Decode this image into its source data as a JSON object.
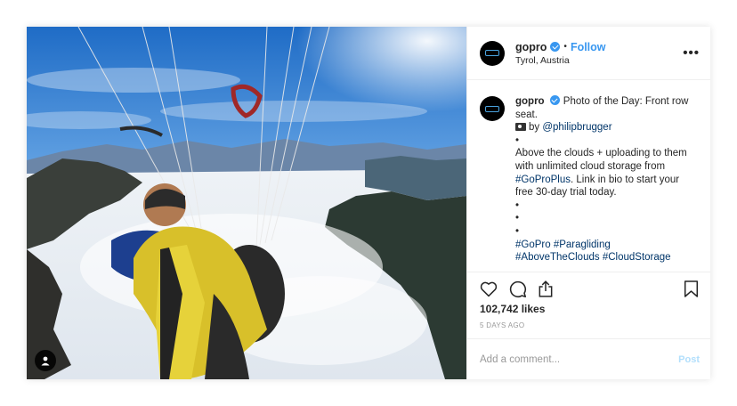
{
  "post": {
    "username": "gopro",
    "follow_label": "Follow",
    "separator": "•",
    "location": "Tyrol, Austria",
    "more_label": "•••"
  },
  "caption": {
    "username": "gopro",
    "line1": "Photo of the Day: Front row seat.",
    "by_label": "by",
    "credit": "@philipbrugger",
    "bullet": "•",
    "body1": "Above the clouds + uploading to them with unlimited cloud storage from",
    "body_tag": "#GoProPlus",
    "body2": ". Link in bio to start your free 30-day trial today.",
    "tags_line1": [
      "#GoPro",
      "#Paragliding"
    ],
    "tags_line2": [
      "#AboveTheClouds",
      "#CloudStorage"
    ]
  },
  "stats": {
    "likes": "102,742 likes",
    "time_ago": "5 DAYS AGO"
  },
  "comment": {
    "placeholder": "Add a comment...",
    "post_label": "Post"
  },
  "icons": [
    "heart-icon",
    "comment-icon",
    "share-icon",
    "bookmark-icon",
    "user-tag-icon",
    "verified-badge-icon"
  ],
  "colors": {
    "accent": "#3897f0",
    "link": "#003569",
    "post_disabled": "#b2dffc",
    "muted": "#999999"
  }
}
